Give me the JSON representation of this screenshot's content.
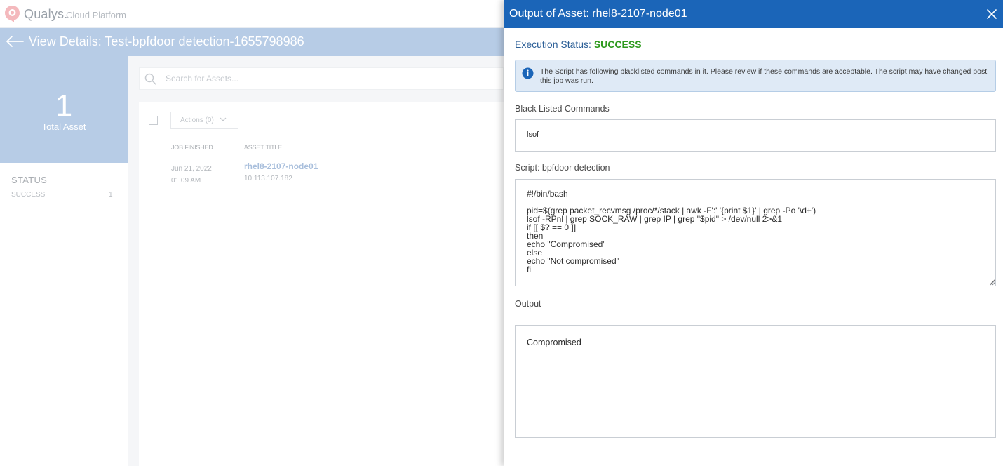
{
  "app": {
    "logo_text": "Qualys.",
    "logo_sub": "Cloud Platform"
  },
  "page": {
    "title": "View Details: Test-bpfdoor detection-1655798986"
  },
  "summary": {
    "total_count": "1",
    "total_label": "Total Asset"
  },
  "status_filter": {
    "heading": "STATUS",
    "items": [
      {
        "label": "SUCCESS",
        "count": "1"
      }
    ]
  },
  "search": {
    "placeholder": "Search for Assets..."
  },
  "toolbar": {
    "actions_label": "Actions (0)"
  },
  "table": {
    "columns": [
      "JOB FINISHED",
      "ASSET TITLE"
    ],
    "rows": [
      {
        "date": "Jun 21, 2022",
        "time": "01:09 AM",
        "asset": "rhel8-2107-node01",
        "ip": "10.113.107.182"
      }
    ]
  },
  "drawer": {
    "title_prefix": "Output of Asset: ",
    "title_asset": "rhel8-2107-node01",
    "exec_status_label": "Execution Status: ",
    "exec_status_value": "SUCCESS",
    "info_message": "The Script has following blacklisted commands in it. Please review if these commands are acceptable. The script may have changed post this job was run.",
    "blacklist_label": "Black Listed Commands",
    "blacklist_value": "lsof",
    "script_label": "Script: bpfdoor detection",
    "script_value": "#!/bin/bash\n\npid=$(grep packet_recvmsg /proc/*/stack | awk -F':' '{print $1}' | grep -Po '\\d+')\nlsof -RPnl | grep SOCK_RAW | grep IP | grep \"$pid\" > /dev/null 2>&1\nif [[ $? == 0 ]]\nthen\necho \"Compromised\"\nelse\necho \"Not compromised\"\nfi",
    "output_label": "Output",
    "output_value": "Compromised"
  },
  "colors": {
    "header_blue": "#1b65b8",
    "dim_blue": "#b7cce6",
    "success_green": "#2e9a1e",
    "info_bg": "#dfeaf6"
  },
  "icons": {
    "logo": "qualys-logo-icon",
    "back": "back-arrow-icon",
    "search": "search-icon",
    "chevron": "chevron-down-icon",
    "info": "info-icon",
    "close": "close-icon"
  }
}
